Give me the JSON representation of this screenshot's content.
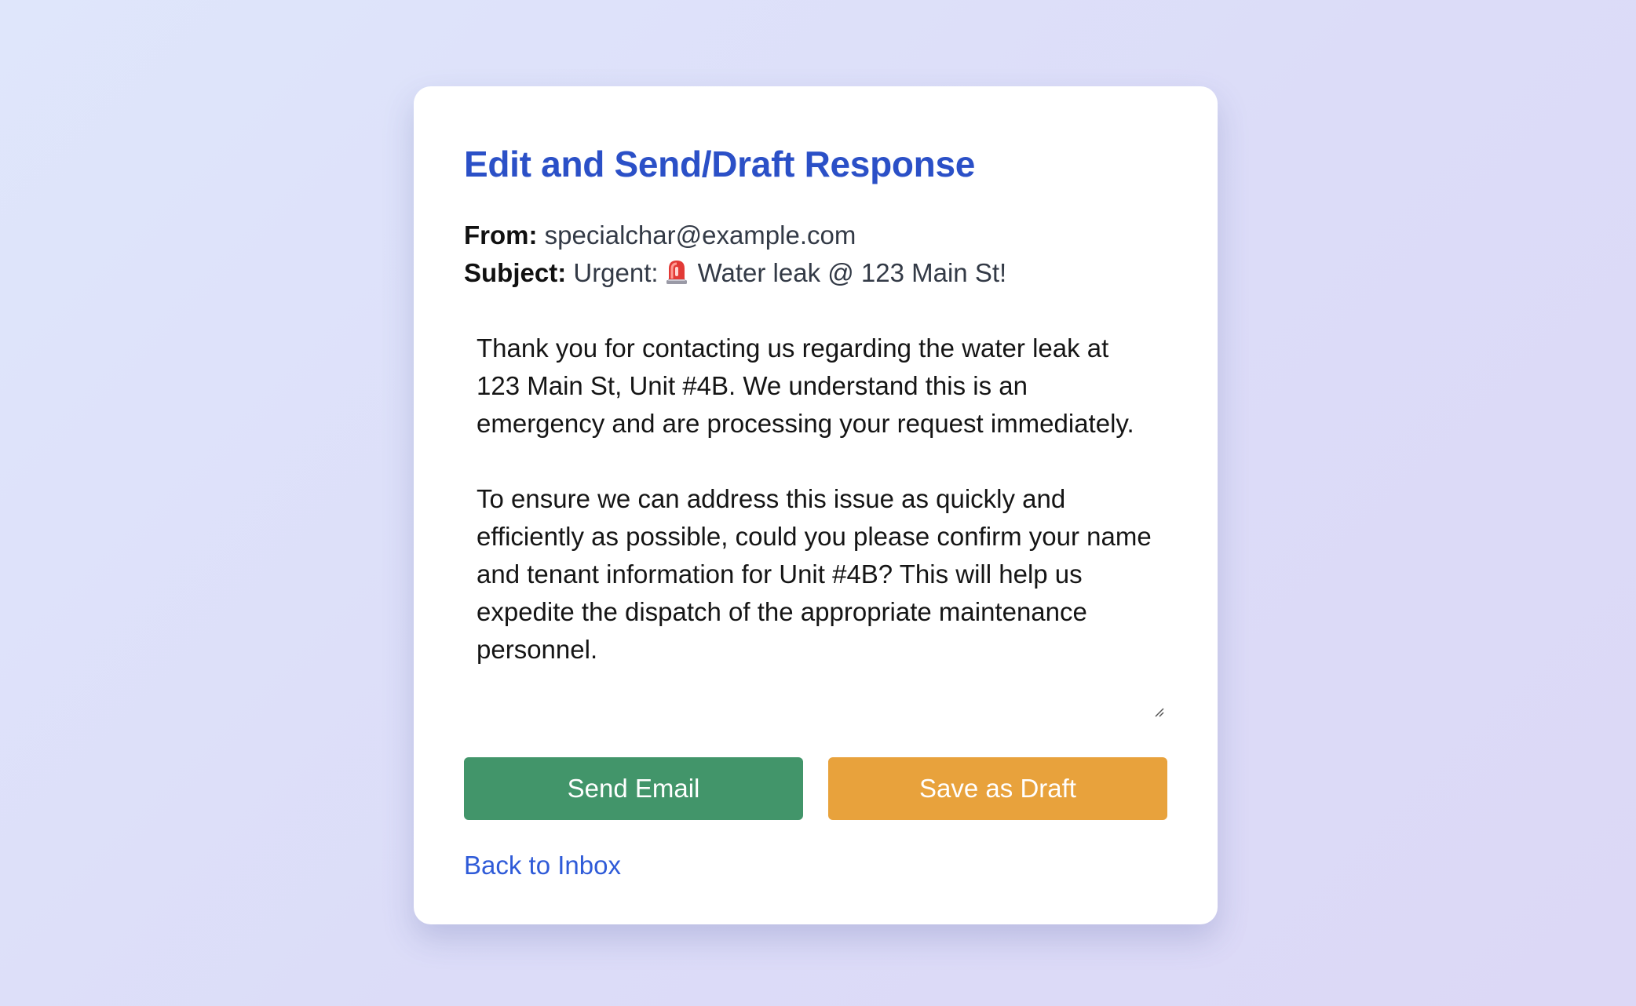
{
  "page": {
    "title": "Edit and Send/Draft Response"
  },
  "email": {
    "from_label": "From:",
    "from_value": "specialchar@example.com",
    "subject_label": "Subject:",
    "subject_prefix": "Urgent:",
    "subject_icon": "siren-icon",
    "subject_rest": "Water leak @ 123 Main St!"
  },
  "response": {
    "body": "Thank you for contacting us regarding the water leak at 123 Main St, Unit #4B. We understand this is an emergency and are processing your request immediately.\n\nTo ensure we can address this issue as quickly and efficiently as possible, could you please confirm your name and tenant information for Unit #4B? This will help us expedite the dispatch of the appropriate maintenance personnel."
  },
  "actions": {
    "send_label": "Send Email",
    "draft_label": "Save as Draft",
    "back_label": "Back to Inbox"
  },
  "colors": {
    "title": "#2b50c7",
    "send_button": "#42956a",
    "draft_button": "#e8a23c",
    "link": "#2f5bd8"
  }
}
